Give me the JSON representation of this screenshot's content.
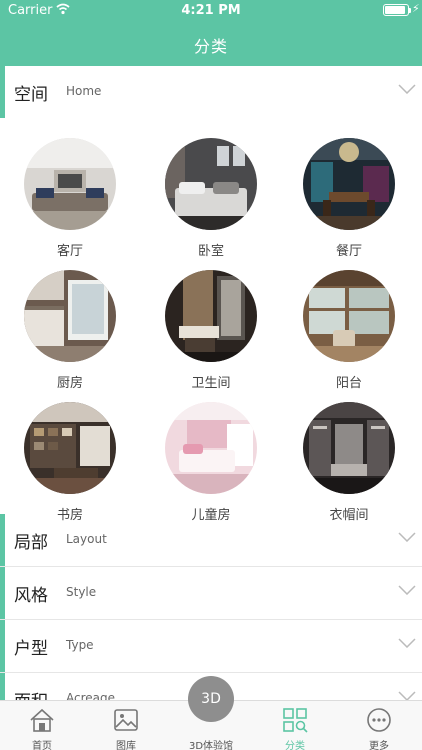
{
  "status_bar": {
    "carrier": "Carrier",
    "time": "4:21 PM",
    "battery_level": 0.9
  },
  "header": {
    "title": "分类"
  },
  "sections": [
    {
      "cn": "空间",
      "en": "Home"
    },
    {
      "cn": "局部",
      "en": "Layout"
    },
    {
      "cn": "风格",
      "en": "Style"
    },
    {
      "cn": "户型",
      "en": "Type"
    },
    {
      "cn": "面积",
      "en": "Acreage"
    }
  ],
  "categories": [
    {
      "label": "客厅",
      "image": "living-room-photo"
    },
    {
      "label": "卧室",
      "image": "bedroom-photo"
    },
    {
      "label": "餐厅",
      "image": "dining-room-photo"
    },
    {
      "label": "厨房",
      "image": "kitchen-photo"
    },
    {
      "label": "卫生间",
      "image": "bathroom-photo"
    },
    {
      "label": "阳台",
      "image": "balcony-photo"
    },
    {
      "label": "书房",
      "image": "study-photo"
    },
    {
      "label": "儿童房",
      "image": "kids-room-photo"
    },
    {
      "label": "衣帽间",
      "image": "closet-photo"
    }
  ],
  "tabbar": {
    "home": "首页",
    "gallery": "图库",
    "experience": "3D体验馆",
    "experience_badge": "3D",
    "category": "分类",
    "more": "更多"
  },
  "colors": {
    "accent": "#5cc5a4",
    "tab_active": "#5cc5a4",
    "badge": "#8e8e8e"
  }
}
